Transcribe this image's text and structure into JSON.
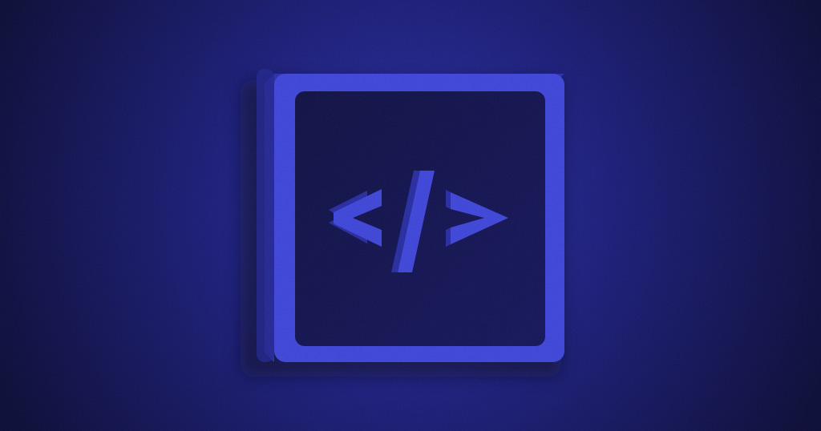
{
  "illustration": {
    "icon": "code-brackets-icon",
    "colors": {
      "background_center": "#2a2fa6",
      "background_mid": "#1a1c78",
      "background_edge": "#0a0b36",
      "frame": "#3e45d8",
      "frame_side": "#2a2fa6",
      "panel": "#14155a",
      "glyph": "#3e45d8",
      "glyph_side": "#272ca0"
    }
  }
}
